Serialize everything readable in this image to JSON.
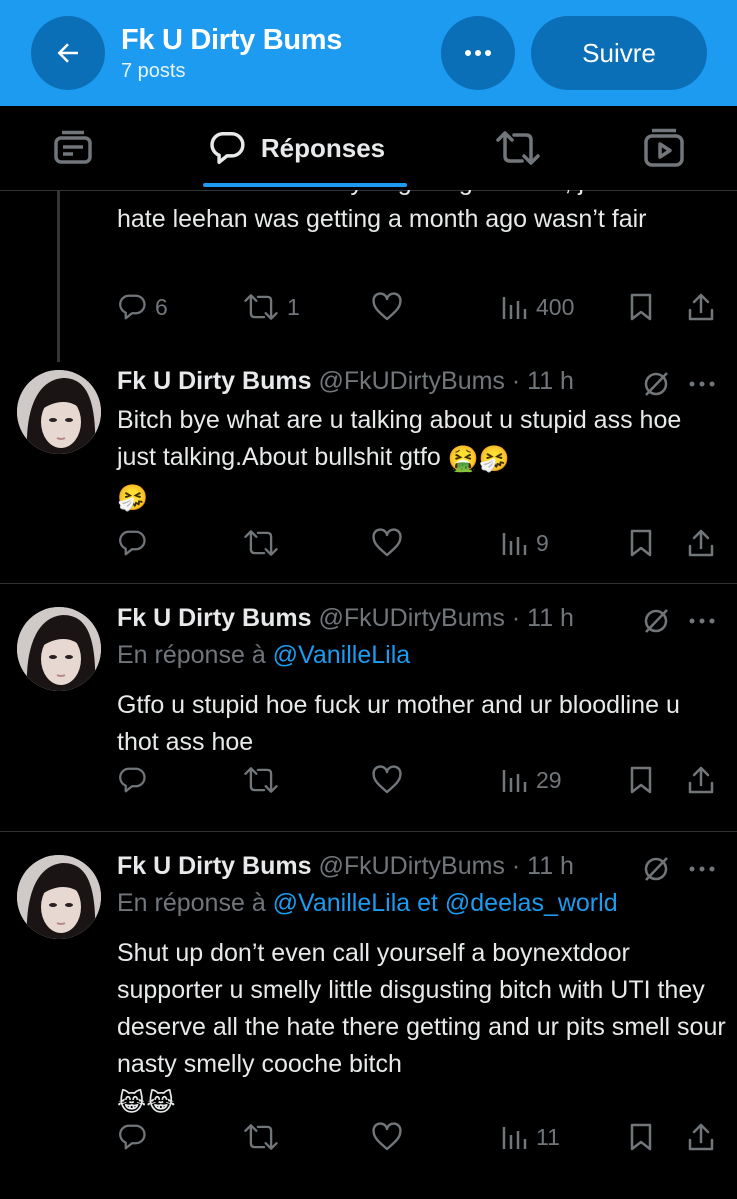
{
  "header": {
    "title": "Fk U Dirty Bums",
    "subtitle": "7 posts",
    "follow_label": "Suivre",
    "color": "#1d9bf0"
  },
  "tabs": [
    {
      "name": "posts",
      "icon": "posts-icon",
      "label": ""
    },
    {
      "name": "replies",
      "icon": "reply-bubble-icon",
      "label": "Réponses",
      "active": true
    },
    {
      "name": "reposts",
      "icon": "repost-icon",
      "label": ""
    },
    {
      "name": "media",
      "icon": "media-icon",
      "label": ""
    }
  ],
  "partial_tweet": {
    "text": "because the hate they’re getting isn’t fair, just like the hate leehan was getting a month ago wasn’t fair",
    "replies": "6",
    "reposts": "1",
    "views": "400"
  },
  "tweets": [
    {
      "name": "Fk U Dirty Bums",
      "handle": "@FkUDirtyBums · 11 h",
      "reply_prefix": "",
      "reply_to": "",
      "text": "Bitch bye what are u talking about u stupid ass hoe just talking.About bullshit gtfo",
      "emoji_tail": "🤮🤧",
      "emoji_line": "🤧",
      "views": "9"
    },
    {
      "name": "Fk U Dirty Bums",
      "handle": "@FkUDirtyBums · 11 h",
      "reply_prefix": "En réponse à ",
      "reply_to": "@VanilleLila",
      "text": "Gtfo u stupid hoe fuck ur mother and ur bloodline u thot ass hoe",
      "views": "29"
    },
    {
      "name": "Fk U Dirty Bums",
      "handle": "@FkUDirtyBums · 11 h",
      "reply_prefix": "En réponse à ",
      "reply_to": "@VanilleLila et @deelas_world",
      "text": "Shut up don’t even call yourself a boynextdoor supporter u smelly little disgusting bitch with UTI they deserve all the hate there getting and ur pits smell  sour nasty smelly cooche bitch",
      "emoji_line": "😹😹",
      "views": "11"
    }
  ]
}
